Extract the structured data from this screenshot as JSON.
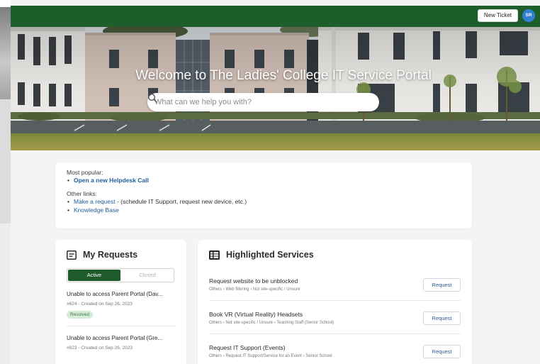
{
  "header": {
    "new_ticket_label": "New Ticket",
    "avatar_initials": "SR",
    "bar_color": "#1d5e2b",
    "avatar_color": "#2f7fd3"
  },
  "hero": {
    "title": "Welcome to The Ladies' College IT Service Portal",
    "search_placeholder": "What can we help you with?",
    "search_value": ""
  },
  "links": {
    "most_popular_label": "Most popular:",
    "popular": [
      {
        "label": "Open a new Helpdesk Call"
      }
    ],
    "other_label": "Other links:",
    "other": [
      {
        "label": "Make a request",
        "suffix": " - (schedule IT Support, request new device, etc.)"
      },
      {
        "label": "Knowledge Base",
        "suffix": ""
      }
    ]
  },
  "requests": {
    "title": "My Requests",
    "icon": "ticket-icon",
    "tabs": [
      {
        "label": "Active",
        "active": true
      },
      {
        "label": "Closed",
        "active": false
      }
    ],
    "items": [
      {
        "title": "Unable to access Parent Portal (Dav...",
        "meta": "#624 - Created on Sep 26, 2023",
        "status": "Resolved"
      },
      {
        "title": "Unable to access Parent Portal (Gre...",
        "meta": "#623 - Created on Sep 26, 2023",
        "status": ""
      }
    ]
  },
  "services": {
    "title": "Highlighted Services",
    "icon": "catalog-icon",
    "button_label": "Request",
    "items": [
      {
        "name": "Request website to be unblocked",
        "sub": "Others › Web filtering › Not site-specific / Unsure"
      },
      {
        "name": "Book VR (Virtual Reality) Headsets",
        "sub": "Others › Not site-specific / Unsure › Teaching Staff (Senior School)"
      },
      {
        "name": "Request IT Support (Events)",
        "sub": "Others › Request IT Support/Service for an Event › Senior School"
      }
    ]
  }
}
